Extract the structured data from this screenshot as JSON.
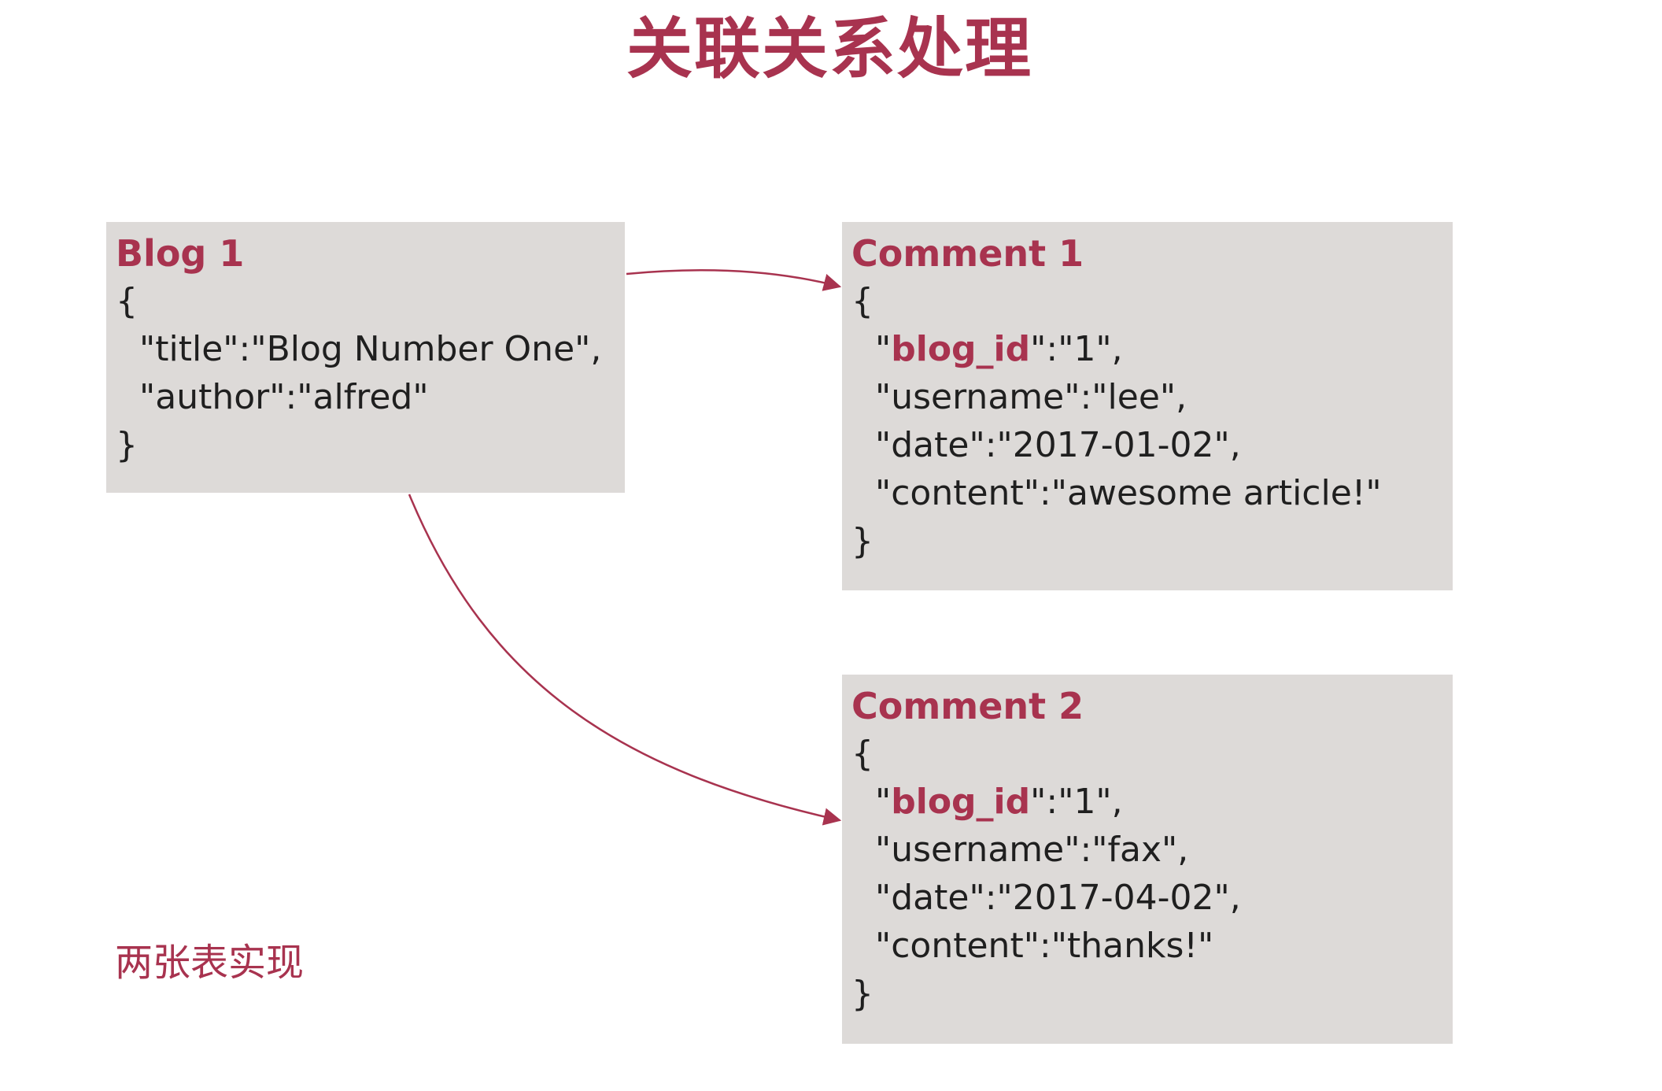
{
  "title": "关联关系处理",
  "accent_color": "#a8334f",
  "blog": {
    "title": "Blog 1",
    "open": "{",
    "lines": [
      "\"title\":\"Blog Number One\",",
      "\"author\":\"alfred\""
    ],
    "close": "}"
  },
  "comments": [
    {
      "title": "Comment 1",
      "open": "{",
      "key_q_open": "\"",
      "key_hl": "blog_id",
      "key_rest": "\":\"1\",",
      "lines": [
        "\"username\":\"lee\",",
        "\"date\":\"2017-01-02\",",
        "\"content\":\"awesome article!\""
      ],
      "close": "}"
    },
    {
      "title": "Comment 2",
      "open": "{",
      "key_q_open": "\"",
      "key_hl": "blog_id",
      "key_rest": "\":\"1\",",
      "lines": [
        "\"username\":\"fax\",",
        "\"date\":\"2017-04-02\",",
        "\"content\":\"thanks!\""
      ],
      "close": "}"
    }
  ],
  "footnote": "两张表实现"
}
